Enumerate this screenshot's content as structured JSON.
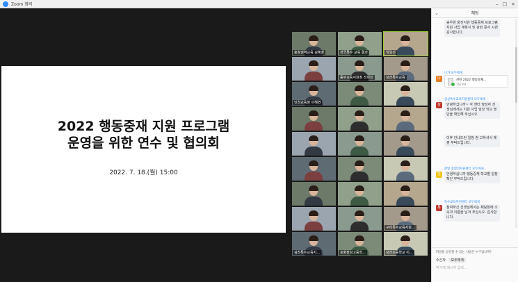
{
  "window": {
    "title": "Zoom 회의"
  },
  "slide": {
    "title_line1": "2022 행동중재 지원 프로그램",
    "title_line2": "운영을 위한 연수 및 협의회",
    "date": "2022. 7. 18.(월) 15:00"
  },
  "gallery": {
    "tiles": [
      {
        "label": "충청권역교육 김혜영",
        "active": false
      },
      {
        "label": "전국특수 교육 결과",
        "active": false
      },
      {
        "label": "임일선",
        "active": true
      },
      {
        "label": "",
        "active": false
      },
      {
        "label": "동부교육지원청 전희진",
        "active": false
      },
      {
        "label": "성산특수교육",
        "active": false
      },
      {
        "label": "인천교육청 이혜연",
        "active": false
      },
      {
        "label": "",
        "active": false
      },
      {
        "label": "",
        "active": false
      },
      {
        "label": "",
        "active": false
      },
      {
        "label": "",
        "active": false
      },
      {
        "label": "",
        "active": false
      },
      {
        "label": "",
        "active": false
      },
      {
        "label": "",
        "active": false
      },
      {
        "label": "",
        "active": false
      },
      {
        "label": "",
        "active": false
      },
      {
        "label": "",
        "active": false
      },
      {
        "label": "",
        "active": false
      },
      {
        "label": "",
        "active": false
      },
      {
        "label": "",
        "active": false
      },
      {
        "label": "",
        "active": false
      },
      {
        "label": "",
        "active": false
      },
      {
        "label": "",
        "active": false
      },
      {
        "label": "구미특수교육지원...",
        "active": false
      },
      {
        "label": "김천특수교육지...",
        "active": false
      },
      {
        "label": "포항장성고등학...",
        "active": false
      },
      {
        "label": "상산초등학교 이...",
        "active": false
      }
    ]
  },
  "chat": {
    "header": "채팅",
    "messages": [
      {
        "sender": "",
        "text": "송우원 울진지원 행동중재 프로그램 지원 사업 계획서 및 관련 문서 시면 감사합니다.",
        "avatar": "",
        "color": "#e06666"
      },
      {
        "sender": "나가 모두에게",
        "file_name": "관련 2022 행동중재...",
        "file_size": "162 KB",
        "avatar": "나",
        "color": "#e67e22"
      },
      {
        "sender": "상상특수교육지원센터 모두에게",
        "text": "안녕하십니까~ 각 센터 담당자 선생님께서는 지원 사업 담당 학교 명 단을 확인해 주십시오.",
        "avatar": "상",
        "color": "#c0392b"
      },
      {
        "sender": "",
        "text": "이후 안내드린 일정 참 고하셔서 제출 부탁드립니다.",
        "avatar": "",
        "color": ""
      },
      {
        "sender": "한빛 종합의지원센터 모두에게",
        "text": "안녕하십니까 행동중재 학교별 일정 확인 부탁드립니다.",
        "avatar": "한",
        "color": "#f1c40f"
      },
      {
        "sender": "특수교육지원센터 모두에게",
        "text": "참여하신 선생님께서는 채팅창에 소속과 이름을 남겨 주십시오. 감사합니다.",
        "avatar": "특",
        "color": "#c0392b"
      }
    ],
    "share_note": "파일을 공유할 수 있는 사람은 누구입니까?",
    "to_label": "수신자:",
    "to_value": "모두에게",
    "input_placeholder": "여기에 메시지 입력..."
  }
}
